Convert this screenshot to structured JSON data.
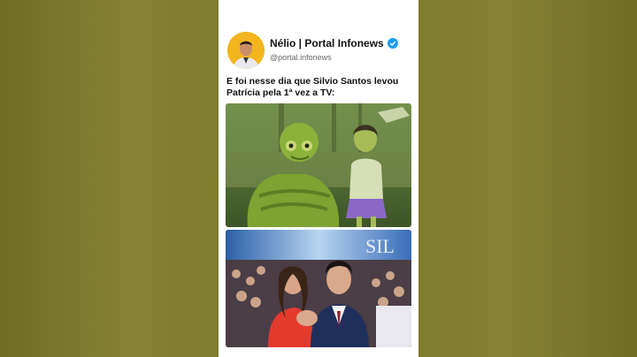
{
  "post": {
    "author_name": "Nélio | Portal Infonews",
    "handle": "@portal.infonews",
    "caption": "E foi nesse dia que Silvio Santos levou Patrícia pela 1ª vez a TV:"
  },
  "photo2": {
    "backdrop_text": "SIL"
  },
  "icons": {
    "verified": "verified-badge-icon",
    "avatar": "profile-avatar"
  },
  "colors": {
    "background": "#7c7a2c",
    "card": "#ffffff",
    "verified_badge": "#1d9bf0",
    "avatar_bg": "#f2b51e"
  }
}
